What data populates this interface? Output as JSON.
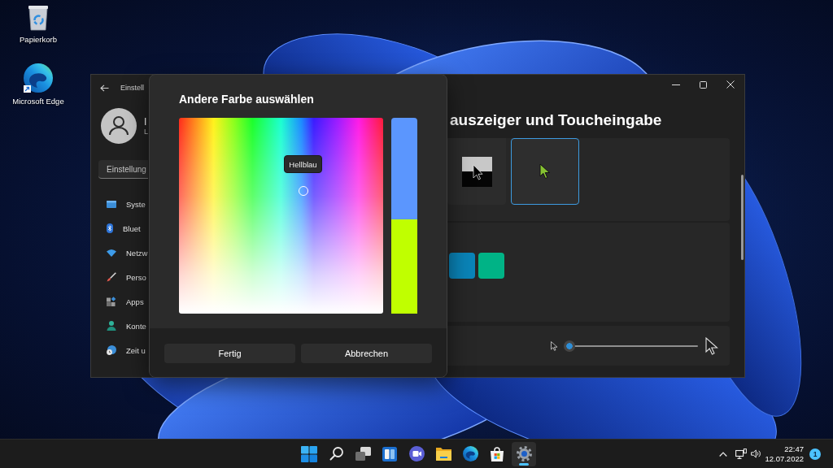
{
  "desktop": {
    "icons": [
      {
        "kind": "recycle-bin",
        "label": "Papierkorb"
      },
      {
        "kind": "edge",
        "label": "Microsoft Edge"
      }
    ]
  },
  "settings_window": {
    "title": "Einstell",
    "profile": {
      "name": "I",
      "subtitle": "L"
    },
    "search": {
      "placeholder": "Einstellung"
    },
    "nav": [
      {
        "kind": "system",
        "label": "Syste",
        "selected": false
      },
      {
        "kind": "bluetooth",
        "label": "Bluet",
        "selected": false
      },
      {
        "kind": "network",
        "label": "Netzw",
        "selected": false
      },
      {
        "kind": "personalization",
        "label": "Perso",
        "selected": false
      },
      {
        "kind": "apps",
        "label": "Apps",
        "selected": false
      },
      {
        "kind": "accounts",
        "label": "Konte",
        "selected": false
      },
      {
        "kind": "time",
        "label": "Zeit u",
        "selected": false
      }
    ],
    "page_title": "auszeiger und Toucheingabe",
    "cursor_styles": [
      {
        "kind": "inverted",
        "selected": false
      },
      {
        "kind": "custom",
        "selected": true
      }
    ],
    "colors": [
      {
        "color": "#0a84b8",
        "selected": false
      },
      {
        "color": "#00b386",
        "selected": false
      }
    ],
    "size_slider": {
      "level": 0
    }
  },
  "color_dialog": {
    "title": "Andere Farbe auswählen",
    "tooltip": "Hellblau",
    "preview": [
      {
        "color": "#5b96fe"
      },
      {
        "color": "#c0ff00"
      }
    ],
    "buttons": [
      {
        "label": "Fertig"
      },
      {
        "label": "Abbrechen"
      }
    ]
  },
  "taskbar": {
    "apps": [
      {
        "kind": "start",
        "selected": false
      },
      {
        "kind": "search",
        "selected": false
      },
      {
        "kind": "task-view",
        "selected": false
      },
      {
        "kind": "widgets",
        "selected": false
      },
      {
        "kind": "chat",
        "selected": false
      },
      {
        "kind": "explorer",
        "selected": false
      },
      {
        "kind": "edge",
        "selected": false
      },
      {
        "kind": "store",
        "selected": false
      },
      {
        "kind": "settings",
        "selected": true
      }
    ],
    "tray": {
      "time": "22:47",
      "date": "12.07.2022",
      "notifications": "1"
    }
  }
}
